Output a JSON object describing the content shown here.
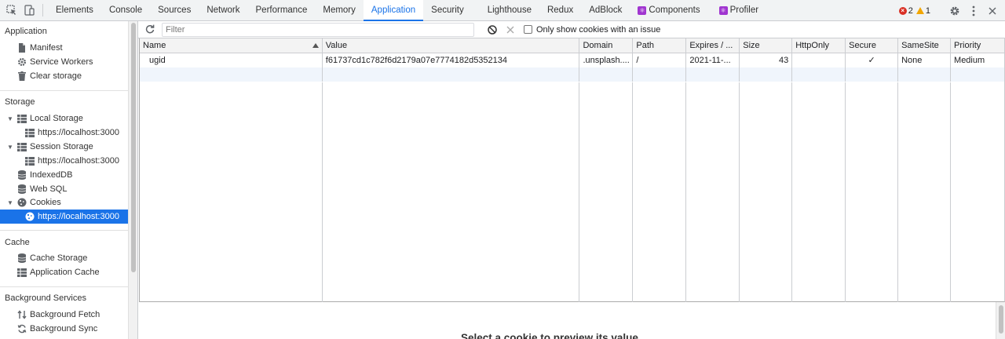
{
  "tabs": [
    "Elements",
    "Console",
    "Sources",
    "Network",
    "Performance",
    "Memory",
    "Application",
    "Security",
    "Lighthouse",
    "Redux",
    "AdBlock",
    "Components",
    "Profiler"
  ],
  "active_tab": "Application",
  "status": {
    "errors": "2",
    "warnings": "1"
  },
  "sidebar": {
    "application": {
      "title": "Application",
      "items": [
        "Manifest",
        "Service Workers",
        "Clear storage"
      ]
    },
    "storage": {
      "title": "Storage",
      "local_storage": "Local Storage",
      "local_storage_child": "https://localhost:3000",
      "session_storage": "Session Storage",
      "session_storage_child": "https://localhost:3000",
      "indexeddb": "IndexedDB",
      "websql": "Web SQL",
      "cookies": "Cookies",
      "cookies_child": "https://localhost:3000"
    },
    "cache": {
      "title": "Cache",
      "items": [
        "Cache Storage",
        "Application Cache"
      ]
    },
    "background": {
      "title": "Background Services",
      "items": [
        "Background Fetch",
        "Background Sync"
      ]
    }
  },
  "toolbar": {
    "filter_placeholder": "Filter",
    "only_issue_label": "Only show cookies with an issue"
  },
  "table": {
    "headers": [
      "Name",
      "Value",
      "Domain",
      "Path",
      "Expires / ...",
      "Size",
      "HttpOnly",
      "Secure",
      "SameSite",
      "Priority"
    ],
    "rows": [
      {
        "name": "ugid",
        "value": "f61737cd1c782f6d2179a07e7774182d5352134",
        "domain": ".unsplash....",
        "path": "/",
        "expires": "2021-11-...",
        "size": "43",
        "httponly": "",
        "secure": "✓",
        "samesite": "None",
        "priority": "Medium"
      }
    ]
  },
  "preview_text": "Select a cookie to preview its value",
  "colors": {
    "accent": "#1a73e8",
    "error": "#d93025",
    "warning": "#f2a600",
    "extension": "#a035d0"
  }
}
